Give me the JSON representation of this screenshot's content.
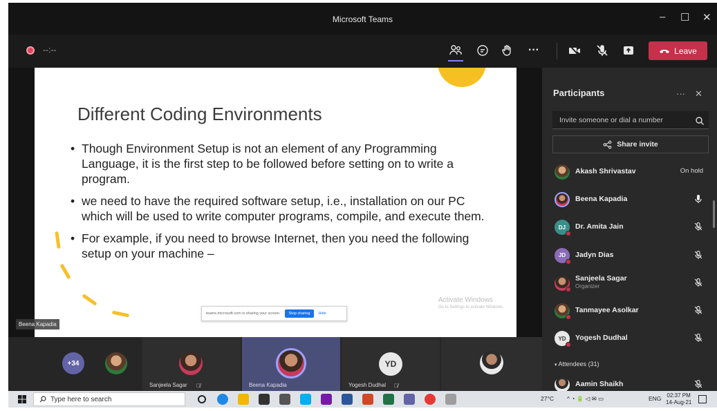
{
  "window": {
    "title": "Microsoft Teams",
    "minimize": "–",
    "maximize": "☐",
    "close": "✕"
  },
  "toolbar": {
    "timer": "--:--",
    "leave_label": "Leave"
  },
  "slide": {
    "title": "Different Coding Environments",
    "bullets": [
      "Though Environment Setup is not an element of any Programming Language, it is the first step to be followed before setting on to write a program.",
      "we need to have the required software setup, i.e., installation on our PC which will be used to write computer programs, compile, and execute them.",
      "For example, if you need to browse Internet, then you need the following setup on your machine –"
    ],
    "watermark_line1": "Activate Windows",
    "watermark_line2": "Go to Settings to activate Windows.",
    "share_notice": "teams.microsoft.com is sharing your screen.",
    "stop_sharing": "Stop sharing",
    "hide": "Hide",
    "presenter": "Beena Kapadia"
  },
  "strip": {
    "overflow_count": "+34",
    "tiles": [
      {
        "name": "Sanjeela Sagar"
      },
      {
        "name": "Beena Kapadia"
      },
      {
        "name": "Yogesh Dudhal",
        "initials": "YD"
      }
    ]
  },
  "panel": {
    "title": "Participants",
    "more": "···",
    "close": "✕",
    "invite_placeholder": "Invite someone or dial a number",
    "share_invite": "Share invite",
    "participants": [
      {
        "name": "Akash Shrivastav",
        "status": "On hold",
        "kind": "photo"
      },
      {
        "name": "Beena Kapadia",
        "kind": "photo2",
        "mic": "on"
      },
      {
        "name": "Dr. Amita Jain",
        "initials": "DJ",
        "color": "#3a8f8a",
        "mic": "muted"
      },
      {
        "name": "Jadyn Dias",
        "initials": "JD",
        "color": "#8a6bb8",
        "mic": "muted"
      },
      {
        "name": "Sanjeela Sagar",
        "role": "Organizer",
        "kind": "photo2",
        "mic": "muted"
      },
      {
        "name": "Tanmayee Asolkar",
        "kind": "photo",
        "mic": "muted"
      },
      {
        "name": "Yogesh Dudhal",
        "initials": "YD",
        "color": "#e8e8e8",
        "mic": "muted"
      },
      {
        "name": "Aamin Shaikh",
        "kind": "photo3",
        "mic": "muted"
      }
    ],
    "attendees": "Attendees (31)"
  },
  "taskbar": {
    "search_placeholder": "Type here to search",
    "weather": "27°C",
    "lang": "ENG",
    "time": "02:37 PM",
    "date": "14-Aug-21"
  },
  "colors": {
    "leave": "#c4314b",
    "accent": "#6264a7",
    "sun": "#f6c023"
  }
}
